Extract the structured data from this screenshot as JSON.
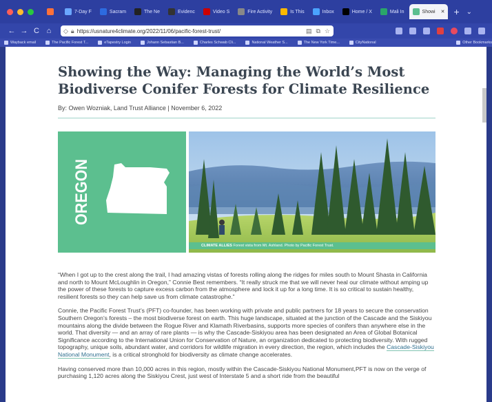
{
  "browser": {
    "tabs": [
      {
        "label": "",
        "color": "#ff7139"
      },
      {
        "label": "7-Day F",
        "color": "#6aa7ff"
      },
      {
        "label": "Sacram",
        "color": "#2d6be0"
      },
      {
        "label": "The Ne",
        "color": "#222"
      },
      {
        "label": "Evidenc",
        "color": "#333"
      },
      {
        "label": "Video S",
        "color": "#cc0000"
      },
      {
        "label": "Fire Activity",
        "color": "#888"
      },
      {
        "label": "Is This",
        "color": "#ffb800"
      },
      {
        "label": "Inbox",
        "color": "#4aa3ff"
      },
      {
        "label": "Home / X",
        "color": "#000"
      },
      {
        "label": "Mali In",
        "color": "#2aa56a"
      },
      {
        "label": "Showi",
        "color": "#5cbf8f"
      }
    ],
    "new_tab": "+",
    "tab_menu": "⌄",
    "nav": {
      "back": "←",
      "forward": "→",
      "reload": "C",
      "home": "⌂"
    },
    "url": "https://usnature4climate.org/2022/11/06/pacific-forest-trust/",
    "bookmarks": [
      "Wayback email",
      "The Pacific Forest T...",
      "eTapestry Login",
      "Johann Sebastian B...",
      "Charles Schwab Cli...",
      "National Weather S...",
      "The New York Time...",
      "CityNational",
      "Other Bookmarks"
    ]
  },
  "article": {
    "title": "Showing the Way: Managing the World’s Most Biodiverse Conifer Forests for Climate Resilience",
    "byline": "By: Owen Wozniak, Land Trust Alliance | November 6, 2022",
    "state_label": "OREGON",
    "caption_bold": "CLIMATE ALLIES",
    "caption_text": " Forest vista from Mt. Ashland. Photo by Pacific Forest Trust.",
    "p1": "“When I got up to the crest along the trail, I had amazing vistas of forests rolling along the ridges for miles south to Mount Shasta in California and north to Mount McLoughlin in Oregon,” Connie Best remembers. “It really struck me that we will never heal our climate without amping up the power of these forests to capture excess carbon from the atmosphere and lock it up for a long time. It is so critical to sustain healthy, resilient forests so they can help save us from climate catastrophe.”",
    "p2_before": "Connie, the Pacific Forest Trust’s (PFT) co-founder, has been working with private and public partners for 18 years to secure the conservation Southern Oregon’s forests – the most biodiverse forest on earth. This huge landscape, situated at the junction of the Cascade and the Siskiyou mountains along the divide between the Rogue River and Klamath Riverbasins, supports more species of conifers than anywhere else in the world. That diversity — and an array of rare plants — is why the Cascade-Siskiyou area has been designated an Area of Global Botanical Significance according to the International Union for Conservation of Nature, an organization dedicated to protecting biodiversity. With rugged topography, unique soils, abundant water, and corridors for wildlife migration in every direction, the region, which includes the ",
    "p2_link": "Cascade-Siskiyou National Monument",
    "p2_after": ", is a critical stronghold for biodiversity as climate change accelerates.",
    "p3": "Having conserved more than 10,000 acres in this region, mostly within the Cascade-Siskiyou National Monument,PFT is now on the verge of purchasing 1,120 acres along the Siskiyou Crest, just west of Interstate 5 and a short ride from the beautiful"
  }
}
